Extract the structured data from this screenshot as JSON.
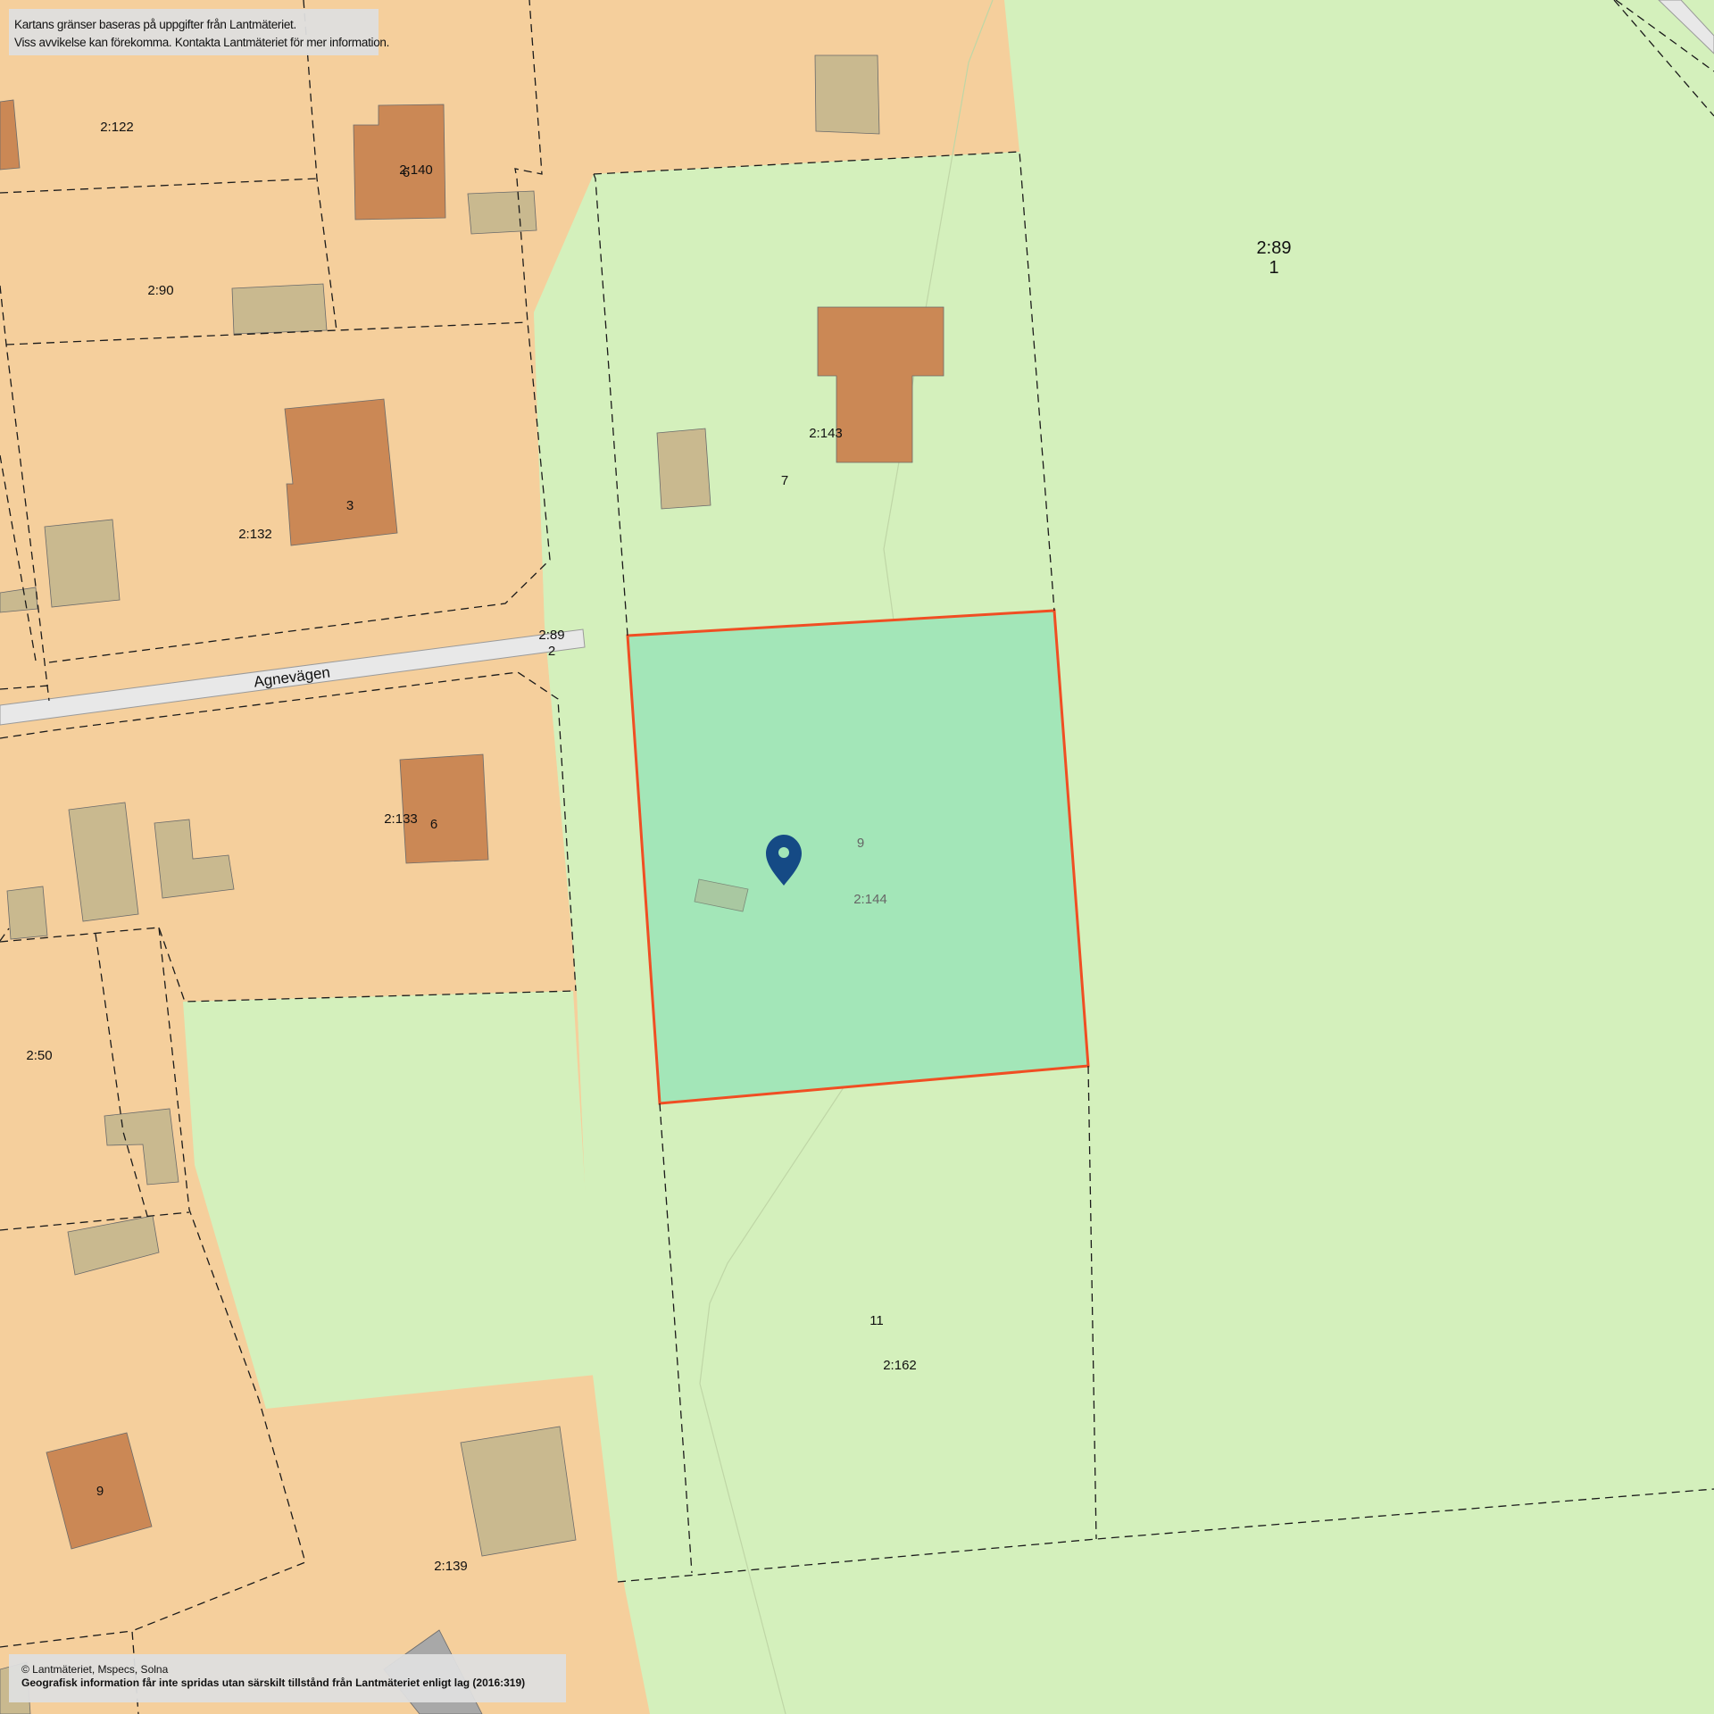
{
  "notice": {
    "line1": "Kartans gränser baseras på uppgifter från Lantmäteriet.",
    "line2": "Viss avvikelse kan förekomma. Kontakta Lantmäteriet för mer information."
  },
  "copyright": {
    "line1": "© Lantmäteriet, Mspecs, Solna",
    "line2": "Geografisk information får inte spridas utan särskilt tillstånd från Lantmäteriet enligt lag (2016:319)"
  },
  "street": {
    "name": "Agnevägen"
  },
  "selected_parcel": {
    "designation": "2:144",
    "address_number": "9",
    "outline_color": "#f04e23",
    "fill_color": "#a3e6b8"
  },
  "marker": {
    "icon": "map-pin-icon",
    "color": "#154a85"
  },
  "colors": {
    "residential": "#f5cf9c",
    "green_area": "#d4f0bc",
    "house": "#cb8855",
    "outbuilding": "#c9b98f",
    "road": "#e8e8e8"
  },
  "labels": {
    "p2_122": "2:122",
    "p2_140": "2:140",
    "n6a": "6",
    "p2_90": "2:90",
    "p2_89_1": "2:89",
    "n1": "1",
    "p2_143": "2:143",
    "n7": "7",
    "n3": "3",
    "p2_132": "2:132",
    "p2_89_2": "2:89",
    "n2": "2",
    "p2_133": "2:133",
    "n6b": "6",
    "n9_sel": "9",
    "p2_144": "2:144",
    "p2_50": "2:50",
    "n11": "11",
    "p2_162": "2:162",
    "n9": "9",
    "p2_139": "2:139"
  }
}
